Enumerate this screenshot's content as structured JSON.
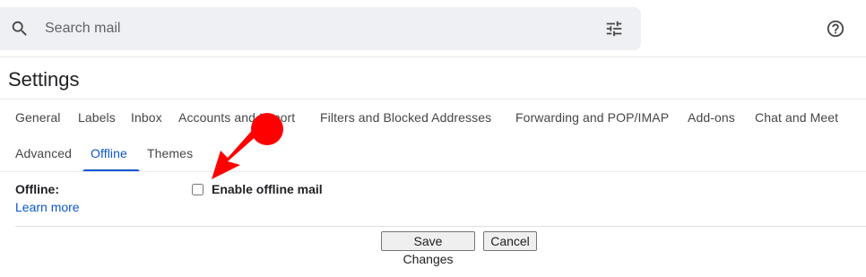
{
  "search": {
    "placeholder": "Search mail"
  },
  "icons": {
    "search": "search-icon",
    "tune": "tune-icon",
    "help": "help-icon"
  },
  "page": {
    "title": "Settings"
  },
  "tabs": [
    {
      "label": "General"
    },
    {
      "label": "Labels"
    },
    {
      "label": "Inbox"
    },
    {
      "label": "Accounts and Import"
    },
    {
      "label": "Filters and Blocked Addresses"
    },
    {
      "label": "Forwarding and POP/IMAP"
    },
    {
      "label": "Add-ons"
    },
    {
      "label": "Chat and Meet"
    },
    {
      "label": "Advanced"
    },
    {
      "label": "Offline",
      "active": true
    },
    {
      "label": "Themes"
    }
  ],
  "offline": {
    "section_label": "Offline:",
    "learn_more": "Learn more",
    "enable_label": "Enable offline mail",
    "enabled": false
  },
  "actions": {
    "save_label": "Save Changes",
    "cancel_label": "Cancel"
  },
  "colors": {
    "accent": "#0b57d0",
    "search_bg": "#eef0f3",
    "annotation_arrow": "#ff0000"
  }
}
